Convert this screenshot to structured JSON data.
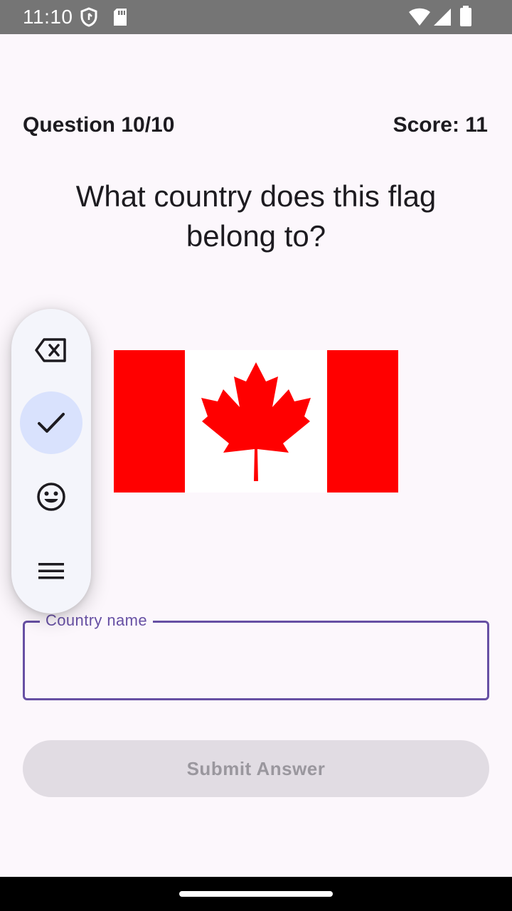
{
  "status_bar": {
    "time": "11:10",
    "icons": [
      "shield-icon",
      "sd-card-icon",
      "wifi-icon",
      "signal-icon",
      "battery-icon"
    ]
  },
  "quiz": {
    "question_counter": "Question 10/10",
    "score": "Score: 11",
    "question": "What country does this flag belong to?",
    "flag": {
      "country_shown": "canada-flag",
      "colors": {
        "red": "#ff0000",
        "white": "#ffffff"
      }
    }
  },
  "toolbar": {
    "items": [
      {
        "icon": "backspace-icon",
        "selected": false
      },
      {
        "icon": "check-icon",
        "selected": true
      },
      {
        "icon": "emoji-icon",
        "selected": false
      },
      {
        "icon": "menu-icon",
        "selected": false
      }
    ]
  },
  "answer_field": {
    "label": "Country name",
    "value": ""
  },
  "submit": {
    "label": "Submit Answer",
    "enabled": false
  },
  "colors": {
    "background": "#fcf7fc",
    "accent": "#6750a4",
    "selected_chip": "#d9e2fd",
    "disabled_button": "#e1dce3"
  }
}
